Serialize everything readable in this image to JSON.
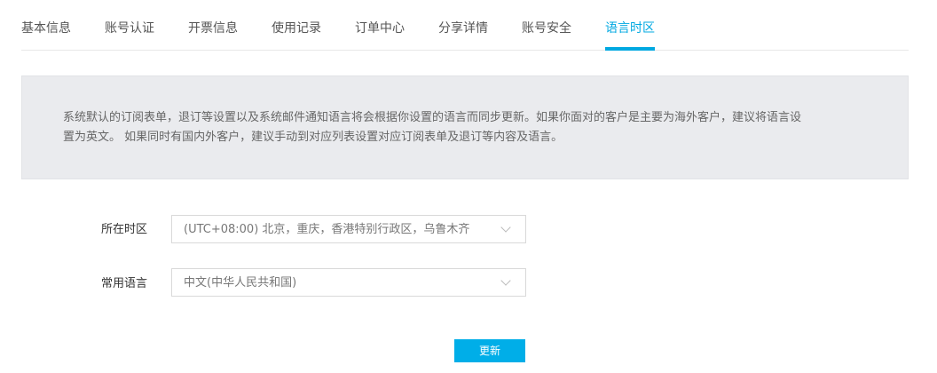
{
  "tabs": [
    {
      "label": "基本信息",
      "active": false
    },
    {
      "label": "账号认证",
      "active": false
    },
    {
      "label": "开票信息",
      "active": false
    },
    {
      "label": "使用记录",
      "active": false
    },
    {
      "label": "订单中心",
      "active": false
    },
    {
      "label": "分享详情",
      "active": false
    },
    {
      "label": "账号安全",
      "active": false
    },
    {
      "label": "语言时区",
      "active": true
    }
  ],
  "notice": {
    "line1": "系统默认的订阅表单，退订等设置以及系统邮件通知语言将会根据你设置的语言而同步更新。如果你面对的客户是主要为海外客户，建议将语言设",
    "line2": "置为英文。 如果同时有国内外客户，建议手动到对应列表设置对应订阅表单及退订等内容及语言。"
  },
  "form": {
    "timezone_label": "所在时区",
    "timezone_value": "(UTC+08:00) 北京，重庆，香港特别行政区，乌鲁木齐",
    "language_label": "常用语言",
    "language_value": "中文(中华人民共和国)"
  },
  "submit_label": "更新",
  "colors": {
    "accent": "#00a8e1",
    "notice_bg": "#eaebee"
  },
  "icons": {
    "select_arrow": "chevron-down-icon"
  }
}
